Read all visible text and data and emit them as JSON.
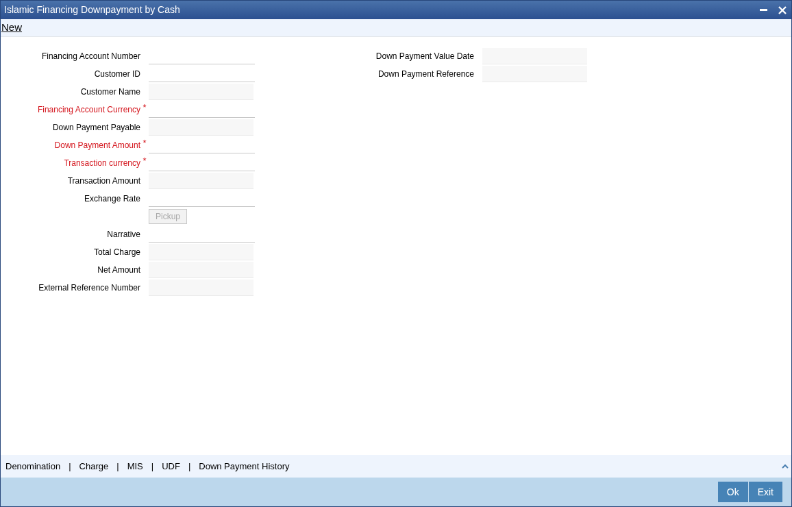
{
  "window": {
    "title": "Islamic Financing Downpayment by Cash"
  },
  "toolbar": {
    "link": "New"
  },
  "left_fields": [
    {
      "kind": "input",
      "label": "Financing Account Number",
      "required": false
    },
    {
      "kind": "input",
      "label": "Customer ID",
      "required": false
    },
    {
      "kind": "readonly",
      "label": "Customer Name",
      "required": false
    },
    {
      "kind": "input",
      "label": "Financing Account Currency",
      "required": true
    },
    {
      "kind": "readonly",
      "label": "Down Payment Payable",
      "required": false
    },
    {
      "kind": "input",
      "label": "Down Payment Amount",
      "required": true
    },
    {
      "kind": "input",
      "label": "Transaction currency",
      "required": true
    },
    {
      "kind": "readonly",
      "label": "Transaction Amount",
      "required": false
    },
    {
      "kind": "input",
      "label": "Exchange Rate",
      "required": false
    },
    {
      "kind": "button",
      "label": "Pickup",
      "disabled": true
    },
    {
      "kind": "input",
      "label": "Narrative",
      "required": false
    },
    {
      "kind": "readonly",
      "label": "Total Charge",
      "required": false
    },
    {
      "kind": "readonly",
      "label": "Net Amount",
      "required": false
    },
    {
      "kind": "readonly",
      "label": "External Reference Number",
      "required": false
    }
  ],
  "right_fields": [
    {
      "kind": "readonly",
      "label": "Down Payment Value Date",
      "required": false
    },
    {
      "kind": "readonly",
      "label": "Down Payment Reference",
      "required": false
    }
  ],
  "required_mark": "*",
  "footer_tabs": {
    "separator": "|",
    "items": [
      "Denomination",
      "Charge",
      "MIS",
      "UDF",
      "Down Payment History"
    ]
  },
  "buttons": [
    "Ok",
    "Exit"
  ]
}
